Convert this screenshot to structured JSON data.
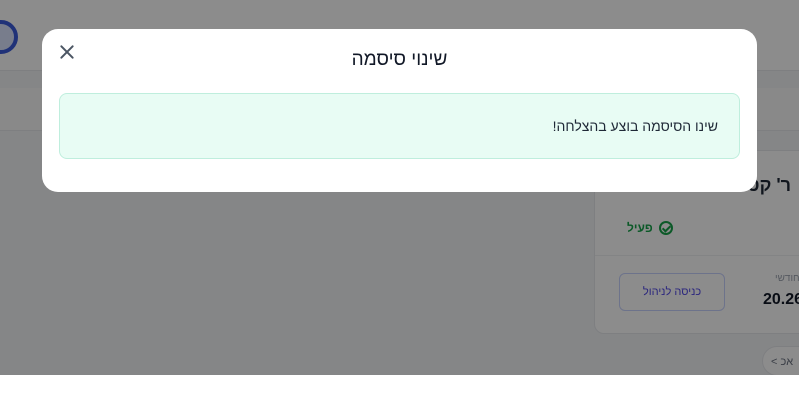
{
  "background": {
    "card": {
      "title": "ר' קטנ",
      "status": "פעיל",
      "renew_label": "חודשי",
      "renew_date": "20.26",
      "portal_button": "כניסה לניהול"
    },
    "more_chip": "< אכ"
  },
  "modal": {
    "title": "שינוי סיסמה",
    "alert_text": "שינו הסיסמה בוצע בהצלחה!"
  },
  "colors": {
    "overlay": "#737373",
    "alert_bg": "#e8fcf4",
    "alert_border": "#bfeedd",
    "success": "#16a34a"
  },
  "icons": {
    "close": "close-icon",
    "status": "check-circle-icon"
  }
}
